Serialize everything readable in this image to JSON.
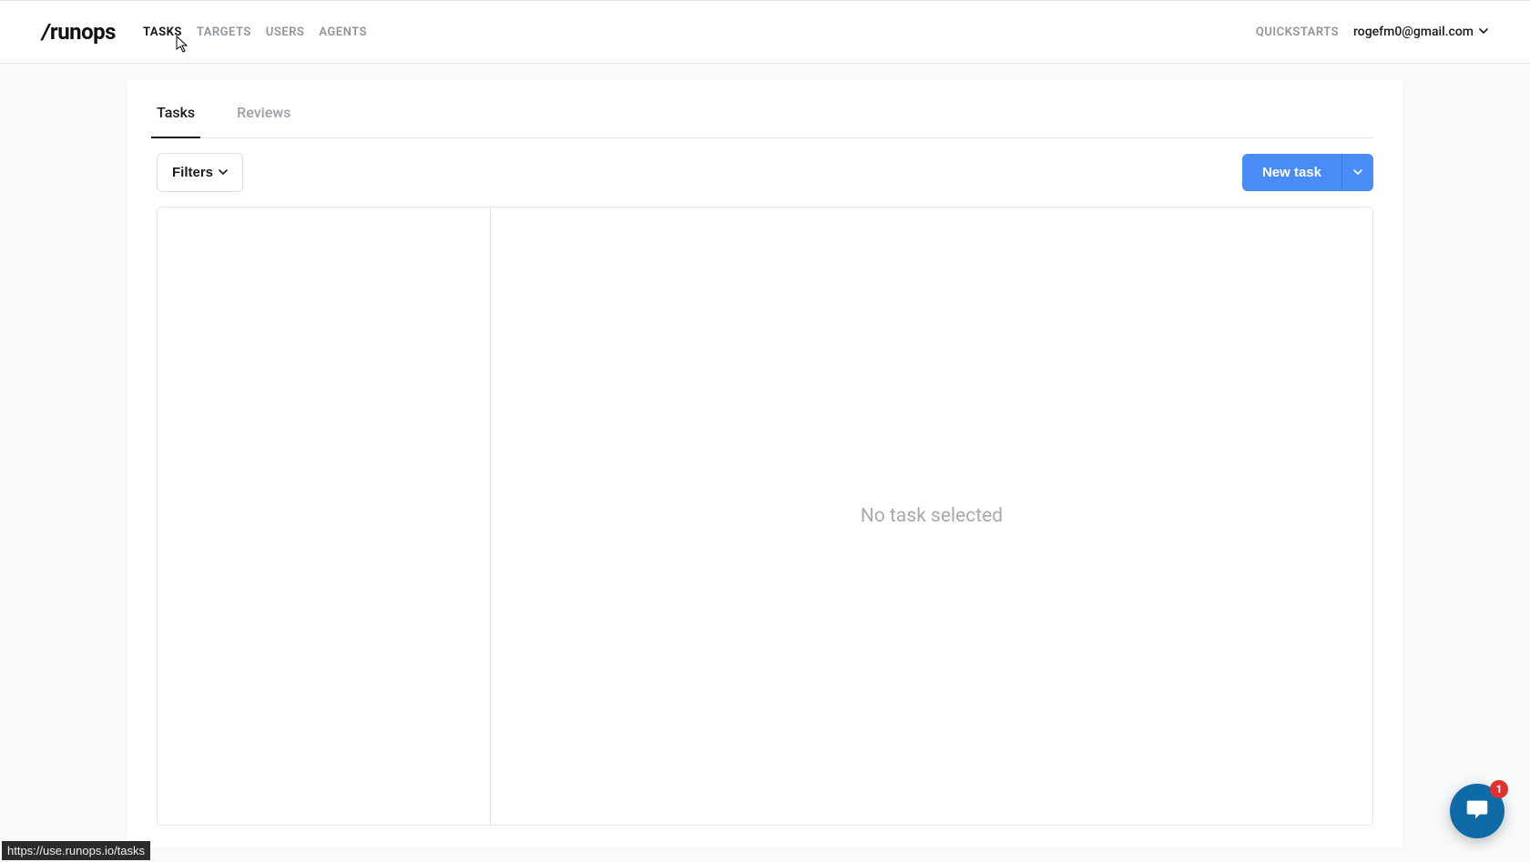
{
  "brand": {
    "name": "runops",
    "slash": "/"
  },
  "nav": {
    "items": [
      {
        "label": "TASKS",
        "active": true
      },
      {
        "label": "TARGETS",
        "active": false
      },
      {
        "label": "USERS",
        "active": false
      },
      {
        "label": "AGENTS",
        "active": false
      }
    ]
  },
  "header_right": {
    "quickstarts": "QUICKSTARTS",
    "user_email": "rogefm0@gmail.com"
  },
  "tabs": [
    {
      "label": "Tasks",
      "active": true
    },
    {
      "label": "Reviews",
      "active": false
    }
  ],
  "toolbar": {
    "filters_label": "Filters",
    "new_task_label": "New task"
  },
  "empty": {
    "message": "No task selected"
  },
  "url_hint": "https://use.runops.io/tasks",
  "chat": {
    "unread_count": "1"
  }
}
